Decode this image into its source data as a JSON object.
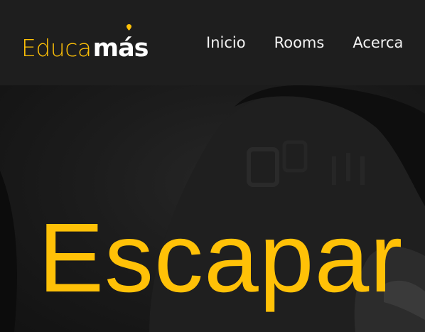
{
  "brand": {
    "name_light": "Educa",
    "name_bold": "más",
    "accent_color": "#ffc107"
  },
  "nav": {
    "items": [
      {
        "label": "Inicio"
      },
      {
        "label": "Rooms"
      },
      {
        "label": "Acerca"
      }
    ]
  },
  "hero": {
    "title": "Escapar"
  }
}
